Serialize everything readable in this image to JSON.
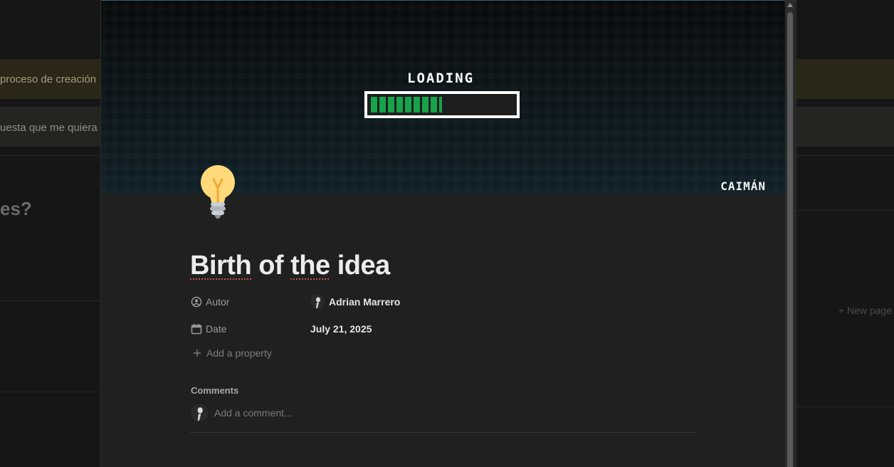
{
  "background": {
    "row1_text": "proceso de creación",
    "row2_text": "uesta que me quiera",
    "heading": "es?",
    "new_page": "New page"
  },
  "cover": {
    "loading_text": "LOADING",
    "progress": 0.5,
    "brand": "CAIMÁN"
  },
  "page": {
    "icon": "lightbulb-icon",
    "title_words": [
      "Birth",
      "of",
      "the",
      "idea"
    ]
  },
  "properties": [
    {
      "label": "Autor",
      "icon": "person-circle-icon",
      "value": "Adrian Marrero"
    },
    {
      "label": "Date",
      "icon": "calendar-icon",
      "value": "July 21, 2025"
    }
  ],
  "add_property": "Add a property",
  "comments": {
    "label": "Comments",
    "placeholder": "Add a comment..."
  },
  "colors": {
    "modal_bg": "#202020",
    "accent_green": "#16a34a",
    "text": "#ececec",
    "muted": "#9b9b9b"
  }
}
